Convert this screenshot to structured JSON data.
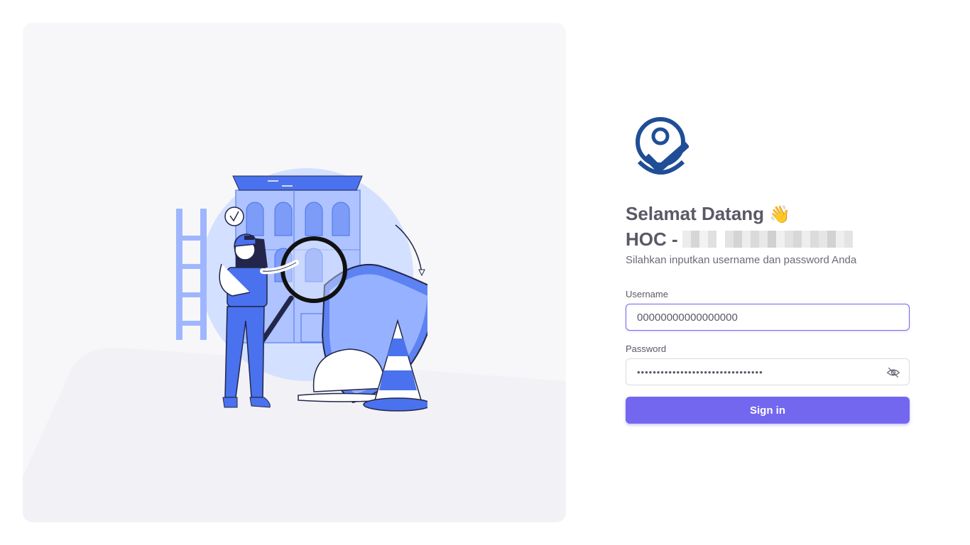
{
  "branding": {
    "logo_icon": "location-check-icon",
    "primary_color": "#7367f0",
    "logo_color": "#1f4e96"
  },
  "welcome": {
    "title": "Selamat Datang",
    "wave_emoji": "👋",
    "app_prefix": "HOC -",
    "lead": "Silahkan inputkan username dan password Anda"
  },
  "form": {
    "username": {
      "label": "Username",
      "value": "00000000000000000"
    },
    "password": {
      "label": "Password",
      "value": "••••••••••••••••••••••••••••••••",
      "toggle_icon": "eye-off-icon"
    },
    "submit_label": "Sign in"
  },
  "illustration": {
    "subject": "inspection-worker-illustration"
  }
}
